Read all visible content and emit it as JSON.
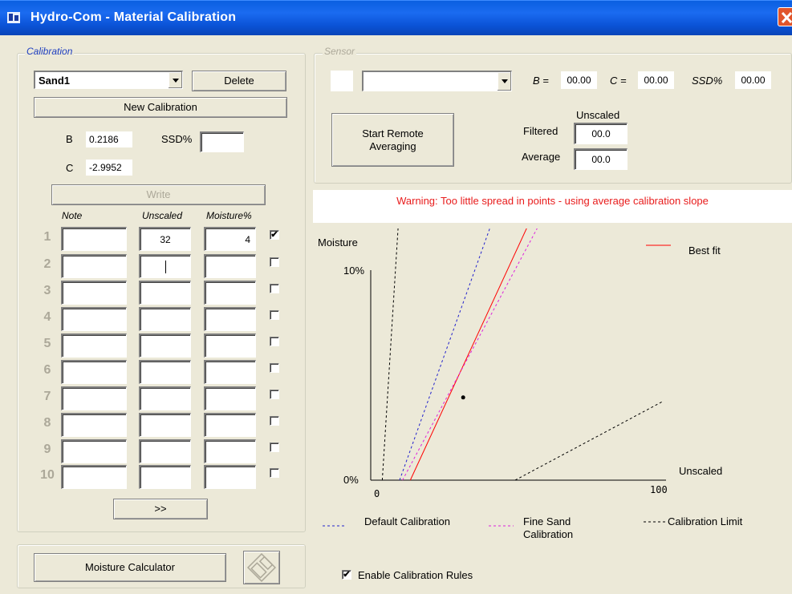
{
  "window": {
    "title": "Hydro-Com - Material Calibration"
  },
  "calibration": {
    "legend": "Calibration",
    "material_selected": "Sand1",
    "delete_label": "Delete",
    "new_label": "New Calibration",
    "b_label": "B",
    "b_value": "0.2186",
    "ssd_label": "SSD%",
    "ssd_value": "",
    "c_label": "C",
    "c_value": "-2.9952",
    "write_label": "Write",
    "col_note": "Note",
    "col_unscaled": "Unscaled",
    "col_moisture": "Moisture%",
    "rows": [
      {
        "num": "1",
        "note": "",
        "unscaled": "32",
        "moisture": "4",
        "checked": "✔"
      },
      {
        "num": "2",
        "note": "",
        "unscaled": "",
        "moisture": "",
        "checked": ""
      },
      {
        "num": "3",
        "note": "",
        "unscaled": "",
        "moisture": "",
        "checked": ""
      },
      {
        "num": "4",
        "note": "",
        "unscaled": "",
        "moisture": "",
        "checked": ""
      },
      {
        "num": "5",
        "note": "",
        "unscaled": "",
        "moisture": "",
        "checked": ""
      },
      {
        "num": "6",
        "note": "",
        "unscaled": "",
        "moisture": "",
        "checked": ""
      },
      {
        "num": "7",
        "note": "",
        "unscaled": "",
        "moisture": "",
        "checked": ""
      },
      {
        "num": "8",
        "note": "",
        "unscaled": "",
        "moisture": "",
        "checked": ""
      },
      {
        "num": "9",
        "note": "",
        "unscaled": "",
        "moisture": "",
        "checked": ""
      },
      {
        "num": "10",
        "note": "",
        "unscaled": "",
        "moisture": "",
        "checked": ""
      }
    ],
    "more_label": ">>"
  },
  "bottom": {
    "moisture_calc_label": "Moisture Calculator",
    "save_icon": "floppy-disk-icon"
  },
  "sensor": {
    "legend": "Sensor",
    "selected": "",
    "b_label": "B =",
    "b_value": "00.00",
    "c_label": "C =",
    "c_value": "00.00",
    "ssd_label": "SSD%",
    "ssd_value": "00.00",
    "remote_label": "Start Remote Averaging",
    "unscaled_header": "Unscaled",
    "filtered_label": "Filtered",
    "filtered_value": "00.0",
    "average_label": "Average",
    "average_value": "00.0"
  },
  "warning": "Warning: Too little spread in points - using average calibration slope",
  "chart": {
    "y_title": "Moisture",
    "y_top_label": "10%",
    "y_bottom_label": "0%",
    "x_title": "Unscaled",
    "x_left_label": "0",
    "x_right_label": "100",
    "legend_bestfit": "Best fit",
    "legend_default": "Default Calibration",
    "legend_fine_l1": "Fine Sand",
    "legend_fine_l2": "Calibration",
    "legend_limit": "Calibration Limit",
    "colors": {
      "bestfit": "#ff0000",
      "default": "#2222cc",
      "fine": "#dd22dd",
      "limit": "#000000"
    }
  },
  "chart_data": {
    "type": "line",
    "xlabel": "Unscaled",
    "ylabel": "Moisture",
    "xlim": [
      0,
      100
    ],
    "ylim": [
      0,
      10
    ],
    "series": [
      {
        "name": "Best fit",
        "x": [
          13.7,
          60
        ],
        "y": [
          0,
          14
        ]
      },
      {
        "name": "Default Calibration",
        "x": [
          10,
          50
        ],
        "y": [
          0,
          15.6
        ]
      },
      {
        "name": "Fine Sand Calibration",
        "x": [
          11,
          78
        ],
        "y": [
          0,
          17.5
        ]
      },
      {
        "name": "Calibration Limit",
        "x": [
          4,
          11,
          50,
          101
        ],
        "y": [
          0,
          15.6,
          0,
          3.8
        ]
      }
    ],
    "points": [
      {
        "x": 32,
        "y": 4
      }
    ]
  },
  "enable_rules": {
    "label": "Enable Calibration Rules",
    "checked": "✔"
  }
}
